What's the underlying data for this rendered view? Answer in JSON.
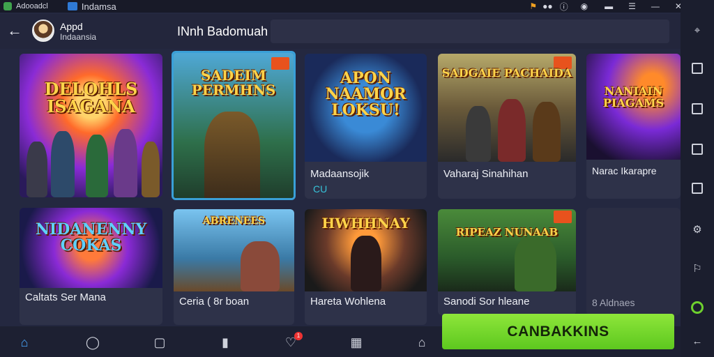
{
  "titlebar": {
    "app_label": "Adooadcl",
    "tab_title": "Indamsa"
  },
  "header": {
    "app_name": "Appd",
    "app_sub": "Indaansia",
    "page_title": "INnh Badomuah"
  },
  "cards": [
    {
      "art_title": "DELOHLS ISAGANA",
      "label": "",
      "sub": ""
    },
    {
      "art_title": "SADEIM PERMHNS",
      "label": "",
      "sub": ""
    },
    {
      "art_title": "APON NAAMOR LOKSU!",
      "label": "Madaansojik",
      "sub": "CU"
    },
    {
      "art_title": "SADGAIE PACHAIDA",
      "label": "Vaharaj Sinahihan",
      "sub": ""
    },
    {
      "art_title": "NANIAIN PIAGAMS",
      "label": "Narac Ikarapre",
      "sub": ""
    },
    {
      "art_title": "NIDANENNY COKAS",
      "label": "Caltats Ser Mana",
      "sub": ""
    },
    {
      "art_title": "ABRENEES",
      "label": "Ceria ( 8r boan",
      "sub": ""
    },
    {
      "art_title": "HWHHNAY",
      "label": "Hareta Wohlena",
      "sub": ""
    },
    {
      "art_title": "RIPEAZ NUNAAB",
      "label": "Sanodi Sor hleane",
      "sub": ""
    },
    {
      "art_title": "",
      "label": "8 Aldnaes",
      "sub": ""
    }
  ],
  "cta": {
    "label": "CANBAKKINS"
  },
  "bottom_nav": {
    "notification_count": "1"
  },
  "colors": {
    "accent": "#3aa0d8",
    "cta": "#6fd52a",
    "badge": "#e8521d"
  }
}
